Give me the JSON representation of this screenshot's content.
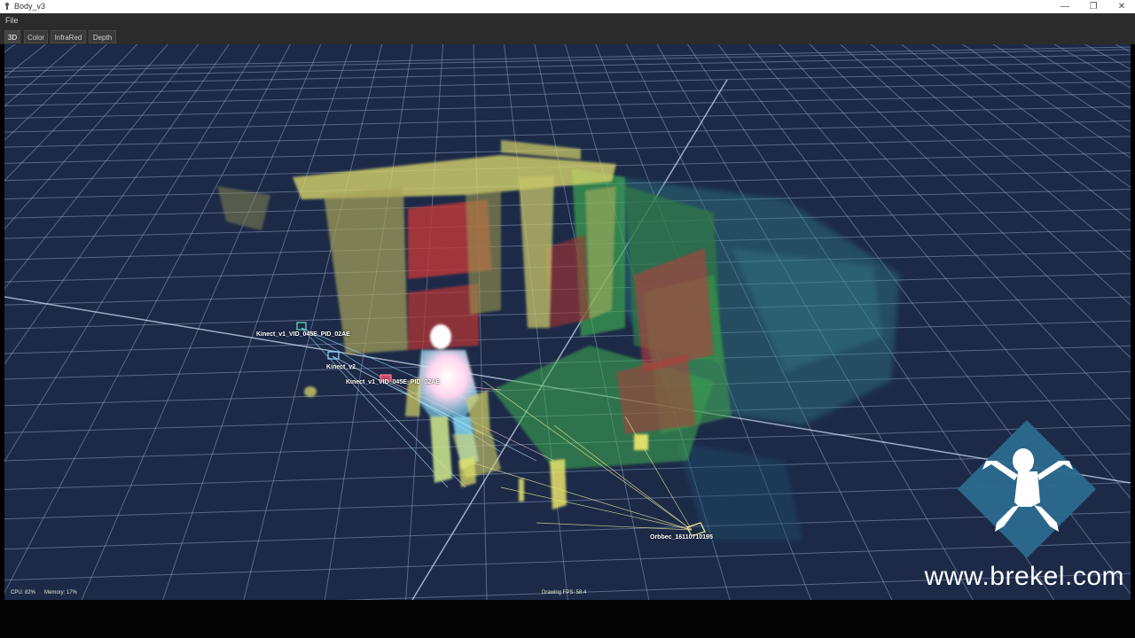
{
  "window": {
    "title": "Body_v3",
    "minimize_glyph": "—",
    "restore_glyph": "❐",
    "close_glyph": "✕"
  },
  "menu": {
    "file": "File"
  },
  "tabs": [
    {
      "label": "3D",
      "active": true
    },
    {
      "label": "Color",
      "active": false
    },
    {
      "label": "InfraRed",
      "active": false
    },
    {
      "label": "Depth",
      "active": false
    }
  ],
  "viewport": {
    "cameras": [
      {
        "label": "Kinect_v1_VID_045E_PID_02AE"
      },
      {
        "label": "Kinect_v2"
      },
      {
        "label": "Kinect_v1_VID_045E_PID_02AE"
      },
      {
        "label": "Orbbec_16110710195"
      }
    ],
    "status": {
      "cpu": "CPU: 82%",
      "memory": "Memory: 17%",
      "fps": "Drawing FPS: 58.4"
    },
    "watermark": "www.brekel.com",
    "colors": {
      "background": "#1c2a48",
      "grid": "#9fb4d6",
      "pointcloud_yellow": "#d6d36a",
      "pointcloud_red": "#c23a3a",
      "pointcloud_green": "#3fae4e",
      "pointcloud_teal": "#2e7f86"
    }
  }
}
